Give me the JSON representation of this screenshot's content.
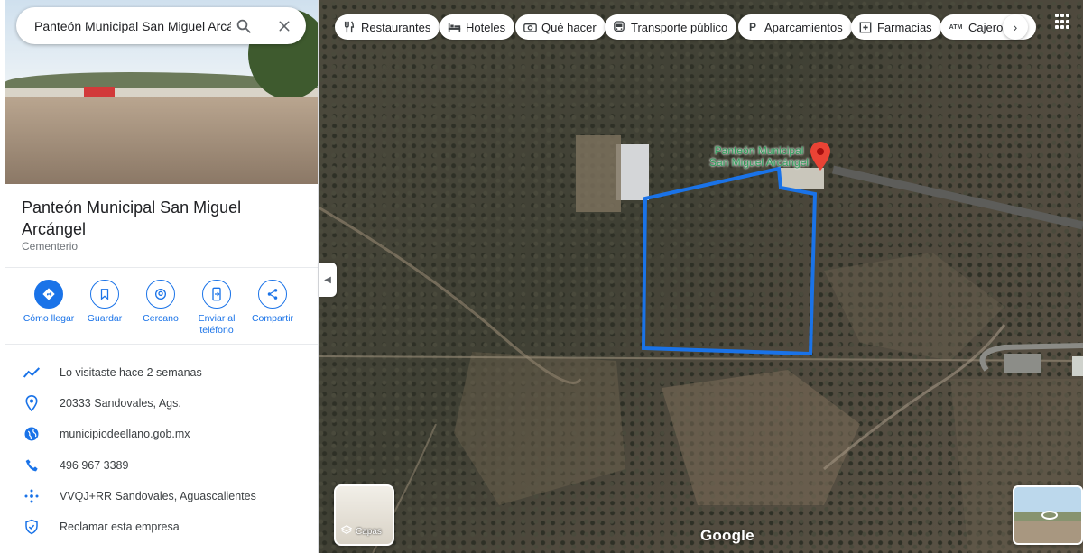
{
  "search": {
    "value": "Panteón Municipal San Miguel Arcán"
  },
  "place": {
    "title": "Panteón Municipal San Miguel Arcángel",
    "category": "Cementerio"
  },
  "actions": [
    {
      "label": "Cómo llegar",
      "icon": "directions-icon"
    },
    {
      "label": "Guardar",
      "icon": "bookmark-icon"
    },
    {
      "label": "Cercano",
      "icon": "nearby-icon"
    },
    {
      "label": "Enviar al teléfono",
      "icon": "send-to-phone-icon"
    },
    {
      "label": "Compartir",
      "icon": "share-icon"
    }
  ],
  "info": [
    {
      "text": "Lo visitaste hace 2 semanas",
      "icon": "visited-trend-icon"
    },
    {
      "text": "20333 Sandovales, Ags.",
      "icon": "location-pin-icon"
    },
    {
      "text": "municipiodeellano.gob.mx",
      "icon": "globe-icon"
    },
    {
      "text": "496 967 3389",
      "icon": "phone-icon"
    },
    {
      "text": "VVQJ+RR Sandovales, Aguascalientes",
      "icon": "plus-code-icon"
    },
    {
      "text": "Reclamar esta empresa",
      "icon": "verified-shield-icon"
    }
  ],
  "chips": [
    {
      "label": "Restaurantes",
      "icon": "fork-knife-icon"
    },
    {
      "label": "Hoteles",
      "icon": "bed-icon"
    },
    {
      "label": "Qué hacer",
      "icon": "camera-icon"
    },
    {
      "label": "Transporte público",
      "icon": "bus-icon"
    },
    {
      "label": "Aparcamientos",
      "icon": "parking-icon"
    },
    {
      "label": "Farmacias",
      "icon": "pharmacy-icon"
    },
    {
      "label": "Cajeros",
      "icon": "atm-icon"
    }
  ],
  "map": {
    "place_label_line1": "Panteón Municipal",
    "place_label_line2": "San Miguel Arcángel",
    "boundary_color": "#1a73e8",
    "pin_color": "#ea4335",
    "label_color": "#2e9e5a"
  },
  "layers": {
    "label": "Capas"
  },
  "brand": {
    "logo": "Google"
  },
  "colors": {
    "accent": "#1a73e8"
  }
}
